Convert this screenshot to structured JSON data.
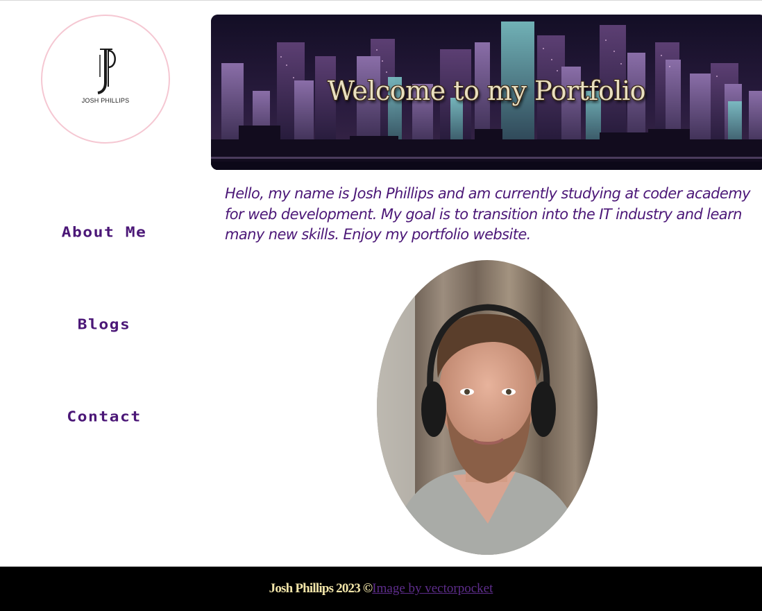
{
  "logo": {
    "monogram": "JP",
    "name": "JOSH PHILLIPS"
  },
  "nav": {
    "about": "About Me",
    "blogs": "Blogs",
    "contact": "Contact"
  },
  "banner": {
    "title": "Welcome to my Portfolio"
  },
  "intro": "Hello, my name is Josh Phillips and am currently studying at coder academy for web development. My goal is to transition into the IT industry and learn many new skills. Enjoy my portfolio website.",
  "footer": {
    "credit": "Josh Phillips 2023 ©",
    "link": "Image by vectorpocket"
  },
  "colors": {
    "accent": "#4b1777",
    "footer_bg": "#000000",
    "footer_text": "#f1e4a8",
    "logo_border": "#f5c7d2"
  },
  "icons": {
    "logo": "jp-monogram-icon",
    "portrait": "person-photo"
  }
}
